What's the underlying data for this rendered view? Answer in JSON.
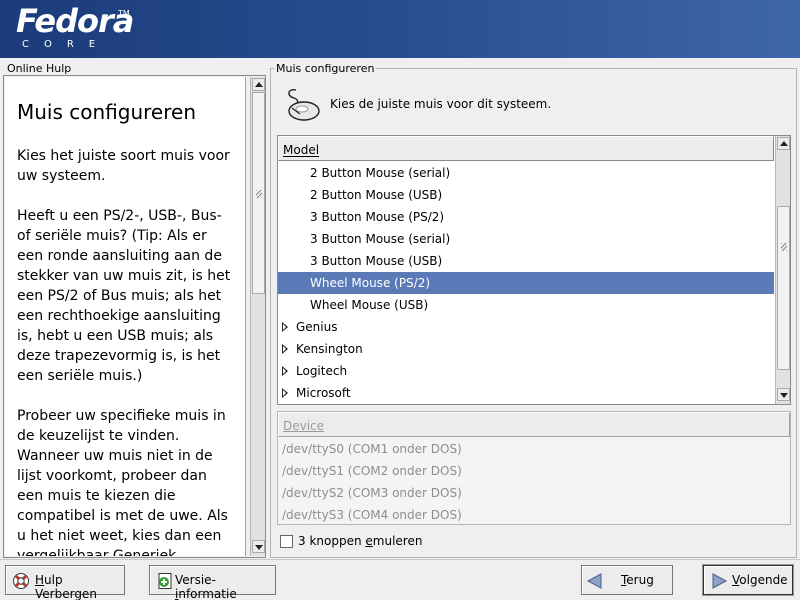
{
  "branding": {
    "name": "Fedora",
    "tm": "TM",
    "subtitle": "CORE"
  },
  "help": {
    "frame_label": "Online Hulp",
    "title": "Muis configureren",
    "paragraphs": [
      "Kies het juiste soort muis voor uw systeem.",
      "Heeft u een PS/2-, USB-, Bus- of seriële muis? (Tip: Als er een ronde aansluiting aan de stekker van uw muis zit, is het een PS/2 of Bus muis; als het een rechthoekige aansluiting is, hebt u een USB muis; als deze trapezevormig is, is het een seriële muis.)",
      "Probeer uw specifieke muis in de keuzelijst te vinden. Wanneer uw muis niet in de lijst voorkomt, probeer dan een muis te kiezen die compatibel is met de uwe. Als u het niet weet, kies dan een vergelijkbaar Generiek"
    ]
  },
  "config": {
    "frame_label": "Muis configureren",
    "instruction": "Kies de juiste muis voor dit systeem.",
    "model_header": "Model",
    "models": [
      {
        "label": "2 Button Mouse (serial)",
        "kind": "child"
      },
      {
        "label": "2 Button Mouse (USB)",
        "kind": "child"
      },
      {
        "label": "3 Button Mouse (PS/2)",
        "kind": "child"
      },
      {
        "label": "3 Button Mouse (serial)",
        "kind": "child"
      },
      {
        "label": "3 Button Mouse (USB)",
        "kind": "child"
      },
      {
        "label": "Wheel Mouse (PS/2)",
        "kind": "child",
        "selected": true
      },
      {
        "label": "Wheel Mouse (USB)",
        "kind": "child"
      },
      {
        "label": "Genius",
        "kind": "parent"
      },
      {
        "label": "Kensington",
        "kind": "parent"
      },
      {
        "label": "Logitech",
        "kind": "parent"
      },
      {
        "label": "Microsoft",
        "kind": "parent"
      }
    ],
    "device_header": "Device",
    "devices": [
      "/dev/ttyS0 (COM1 onder DOS)",
      "/dev/ttyS1 (COM2 onder DOS)",
      "/dev/ttyS2 (COM3 onder DOS)",
      "/dev/ttyS3 (COM4 onder DOS)"
    ],
    "emulate_label": "3 knoppen emuleren",
    "emulate_checked": false
  },
  "buttons": {
    "hide_help": "Hulp Verbergen",
    "release_notes": "Versie-informatie",
    "back": "Terug",
    "next": "Volgende"
  },
  "icons": {
    "mouse": "mouse-icon",
    "hide_help": "lifebuoy-icon",
    "release_notes": "release-notes-icon",
    "back": "arrow-left-icon",
    "next": "arrow-right-icon"
  },
  "colors": {
    "banner": "#274c8e",
    "selection": "#5a7ab7"
  }
}
